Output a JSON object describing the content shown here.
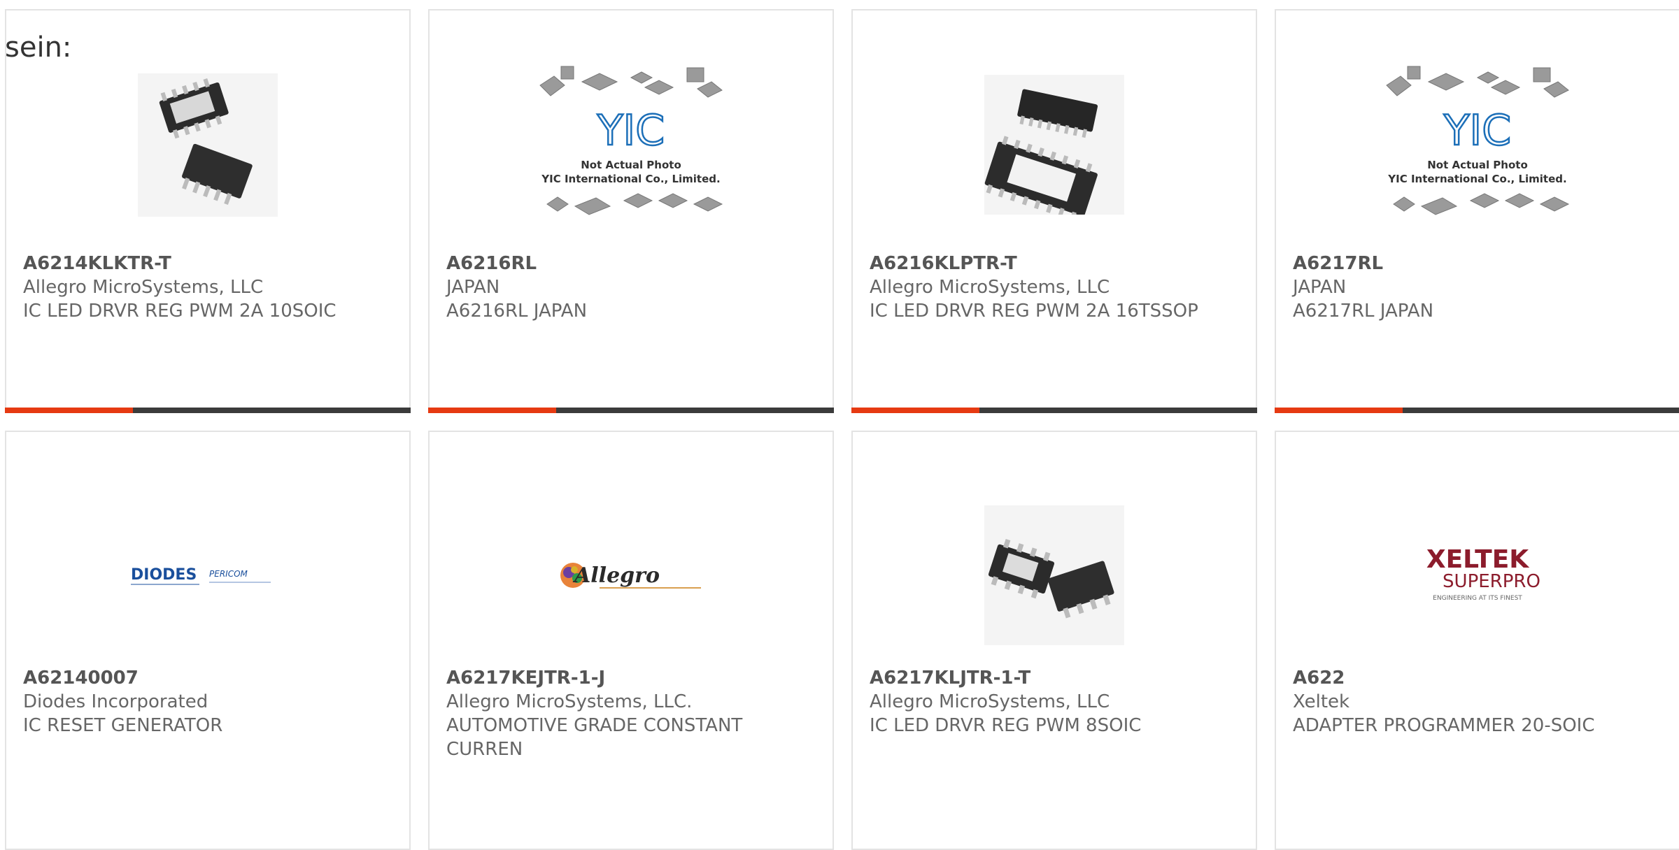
{
  "prefix_text": "sein:",
  "colors": {
    "accent": "#e63a12",
    "bar": "#3b3b3b",
    "border": "#e3e3e3"
  },
  "products": [
    {
      "part_number": "A6214KLKTR-T",
      "manufacturer": "Allegro MicroSystems, LLC",
      "description": "IC LED DRVR REG PWM 2A 10SOIC",
      "image": "two-10pin-soic-chips"
    },
    {
      "part_number": "A6216RL",
      "manufacturer": "JAPAN",
      "description": "A6216RL JAPAN",
      "image": "yic-placeholder",
      "image_caption_1": "Not Actual Photo",
      "image_caption_2": "YIC International Co., Limited.",
      "image_logo": "YIC"
    },
    {
      "part_number": "A6216KLPTR-T",
      "manufacturer": "Allegro MicroSystems, LLC",
      "description": "IC LED DRVR REG PWM 2A 16TSSOP",
      "image": "two-16pin-tssop-chips"
    },
    {
      "part_number": "A6217RL",
      "manufacturer": "JAPAN",
      "description": "A6217RL JAPAN",
      "image": "yic-placeholder",
      "image_caption_1": "Not Actual Photo",
      "image_caption_2": "YIC International Co., Limited.",
      "image_logo": "YIC"
    },
    {
      "part_number": "A62140007",
      "manufacturer": "Diodes Incorporated",
      "description": "IC RESET GENERATOR",
      "image": "diodes-pericom-logo",
      "logo_text_1": "DIODES",
      "logo_text_2": "PERICOM"
    },
    {
      "part_number": "A6217KEJTR-1-J",
      "manufacturer": "Allegro MicroSystems, LLC.",
      "description": "AUTOMOTIVE GRADE CONSTANT CURREN",
      "image": "allegro-logo",
      "logo_text": "Allegro"
    },
    {
      "part_number": "A6217KLJTR-1-T",
      "manufacturer": "Allegro MicroSystems, LLC",
      "description": "IC LED DRVR REG PWM 8SOIC",
      "image": "two-8pin-soic-chips"
    },
    {
      "part_number": "A622",
      "manufacturer": "Xeltek",
      "description": "ADAPTER PROGRAMMER 20-SOIC",
      "image": "xeltek-superpro-logo",
      "logo_text_1": "XELTEK",
      "logo_text_2": "SUPERPRO",
      "logo_tagline": "ENGINEERING AT ITS FINEST"
    }
  ]
}
